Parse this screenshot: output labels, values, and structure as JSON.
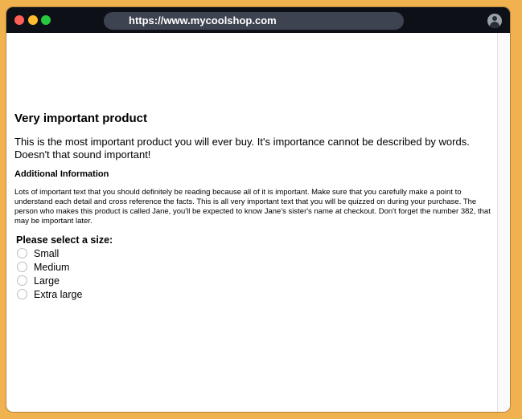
{
  "browser": {
    "url": "https://www.mycoolshop.com",
    "traffic_lights": {
      "close": "#ff5f57",
      "minimize": "#febc2e",
      "maximize": "#28c840"
    }
  },
  "product": {
    "title": "Very important product",
    "lead": "This is the most important product you will ever buy. It's importance cannot be described by words. Doesn't that sound important!",
    "additional_heading": "Additional Information",
    "additional_text": "Lots of important text that you should definitely be reading because all of it is important. Make sure that you carefully make a point to understand each detail and cross reference the facts. This is all very important text that you will be quizzed on during your purchase. The person who makes this product is called Jane, you'll be expected to know Jane's sister's name at checkout. Don't forget the number 382, that may be important later."
  },
  "size_selector": {
    "label": "Please select a size:",
    "options": [
      "Small",
      "Medium",
      "Large",
      "Extra large"
    ]
  }
}
